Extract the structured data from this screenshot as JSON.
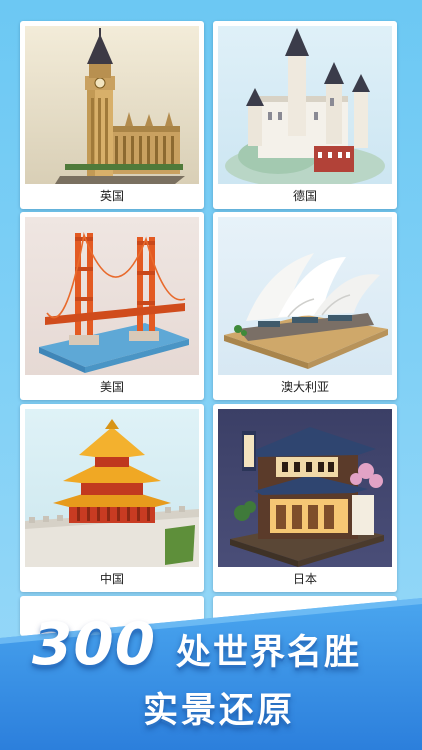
{
  "cards": [
    {
      "label": "英国"
    },
    {
      "label": "德国"
    },
    {
      "label": "美国"
    },
    {
      "label": "澳大利亚"
    },
    {
      "label": "中国"
    },
    {
      "label": "日本"
    }
  ],
  "banner": {
    "count": "300",
    "line1": "处世界名胜",
    "line2": "实景还原"
  }
}
